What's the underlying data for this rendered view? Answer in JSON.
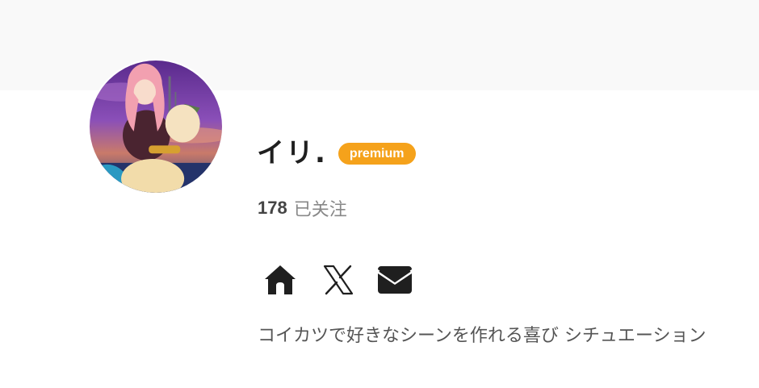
{
  "profile": {
    "name": "イリ.",
    "badge": "premium",
    "following_count": "178",
    "following_label": "已关注",
    "bio": "コイカツで好きなシーンを作れる喜び シチュエーション"
  },
  "links": [
    {
      "icon": "home-icon"
    },
    {
      "icon": "x-icon"
    },
    {
      "icon": "mail-icon"
    }
  ],
  "colors": {
    "badge": "#f5a21b",
    "cover": "#f9f9f9",
    "text": "#1f1f1f",
    "muted": "#888888"
  }
}
